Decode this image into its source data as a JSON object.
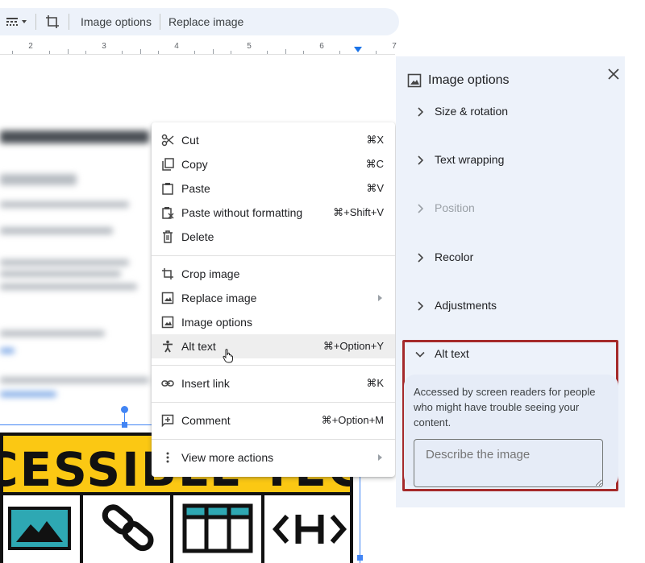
{
  "toolbar": {
    "image_options_label": "Image options",
    "replace_image_label": "Replace image"
  },
  "ruler": {
    "numbers": [
      "2",
      "3",
      "4",
      "5",
      "6",
      "7"
    ]
  },
  "image": {
    "banner_text": "CESSIBLE TECH"
  },
  "context_menu": {
    "items": [
      {
        "label": "Cut",
        "shortcut": "⌘X",
        "icon": "scissors-icon"
      },
      {
        "label": "Copy",
        "shortcut": "⌘C",
        "icon": "copy-icon"
      },
      {
        "label": "Paste",
        "shortcut": "⌘V",
        "icon": "clipboard-icon"
      },
      {
        "label": "Paste without formatting",
        "shortcut": "⌘+Shift+V",
        "icon": "clipboard-clear-icon"
      },
      {
        "label": "Delete",
        "shortcut": "",
        "icon": "trash-icon"
      },
      {
        "label": "Crop image",
        "shortcut": "",
        "icon": "crop-icon"
      },
      {
        "label": "Replace image",
        "shortcut": "",
        "icon": "image-icon",
        "submenu": true
      },
      {
        "label": "Image options",
        "shortcut": "",
        "icon": "image-icon"
      },
      {
        "label": "Alt text",
        "shortcut": "⌘+Option+Y",
        "icon": "accessibility-icon",
        "hovered": true
      },
      {
        "label": "Insert link",
        "shortcut": "⌘K",
        "icon": "link-icon"
      },
      {
        "label": "Comment",
        "shortcut": "⌘+Option+M",
        "icon": "comment-add-icon"
      },
      {
        "label": "View more actions",
        "shortcut": "",
        "icon": "more-vert-icon",
        "submenu": true
      }
    ]
  },
  "side_panel": {
    "title": "Image options",
    "sections": [
      {
        "label": "Size & rotation",
        "expanded": false,
        "disabled": false
      },
      {
        "label": "Text wrapping",
        "expanded": false,
        "disabled": false
      },
      {
        "label": "Position",
        "expanded": false,
        "disabled": true
      },
      {
        "label": "Recolor",
        "expanded": false,
        "disabled": false
      },
      {
        "label": "Adjustments",
        "expanded": false,
        "disabled": false
      },
      {
        "label": "Alt text",
        "expanded": true,
        "disabled": false
      }
    ],
    "alt_text": {
      "description": "Accessed by screen readers for people who might have trouble seeing your content.",
      "placeholder": "Describe the image"
    }
  },
  "colors": {
    "accent_blue": "#1a73e8",
    "highlight_box": "#a52a2a",
    "banner_yellow": "#fbc813",
    "panel_bg": "#edf2fa",
    "tile_teal": "#2ea8b3"
  }
}
